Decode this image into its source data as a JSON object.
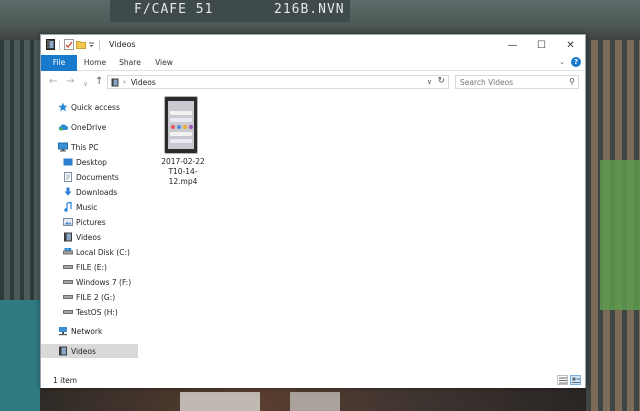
{
  "window": {
    "title": "Videos",
    "controls": {
      "minimize": "—",
      "maximize": "☐",
      "close": "✕"
    }
  },
  "ribbon": {
    "tabs": [
      {
        "label": "File"
      },
      {
        "label": "Home"
      },
      {
        "label": "Share"
      },
      {
        "label": "View"
      }
    ]
  },
  "navbar": {
    "address": "Videos",
    "search_placeholder": "Search Videos"
  },
  "sidebar": {
    "items": [
      {
        "label": "Quick access",
        "icon": "star-icon"
      },
      {
        "label": "OneDrive",
        "icon": "cloud-icon"
      },
      {
        "label": "This PC",
        "icon": "computer-icon"
      },
      {
        "label": "Desktop",
        "icon": "desktop-icon"
      },
      {
        "label": "Documents",
        "icon": "documents-icon"
      },
      {
        "label": "Downloads",
        "icon": "download-icon"
      },
      {
        "label": "Music",
        "icon": "music-icon"
      },
      {
        "label": "Pictures",
        "icon": "pictures-icon"
      },
      {
        "label": "Videos",
        "icon": "videos-icon"
      },
      {
        "label": "Local Disk (C:)",
        "icon": "drive-icon"
      },
      {
        "label": "FILE (E:)",
        "icon": "drive-icon"
      },
      {
        "label": "Windows 7 (F:)",
        "icon": "drive-icon"
      },
      {
        "label": "FILE 2 (G:)",
        "icon": "drive-icon"
      },
      {
        "label": "TestOS (H:)",
        "icon": "drive-icon"
      },
      {
        "label": "Network",
        "icon": "network-icon"
      },
      {
        "label": "Videos",
        "icon": "videos-icon"
      }
    ]
  },
  "content": {
    "files": [
      {
        "name_line1": "2017-02-22",
        "name_line2": "T10-14-12.mp4"
      }
    ]
  },
  "status": {
    "item_count": "1 item"
  },
  "wallpaper": {
    "sign_left": "F/CAFE 51",
    "sign_right": "216B.NVN"
  },
  "colors": {
    "accent": "#1979ca",
    "selected": "#d9d9d9"
  }
}
